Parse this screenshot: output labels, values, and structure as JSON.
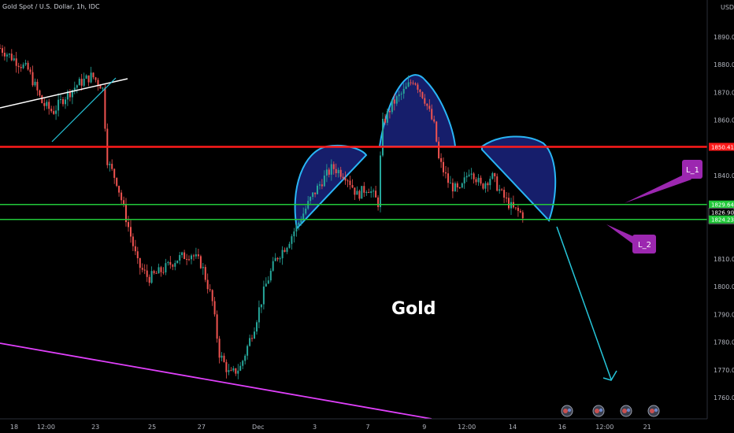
{
  "symbol": "Gold Spot / U.S. Dollar, 1h, IDC",
  "currency": "USD",
  "watermark_label": "Gold",
  "colors": {
    "background": "#000000",
    "up_candle": "#26a69a",
    "down_candle": "#ef5350",
    "resistance": "#ff1a1a",
    "support": "#22c93a",
    "pattern_fill": "#1a237e",
    "pattern_edge": "#29b6f6",
    "projection": "#26c6da",
    "callout": "#9c27b0",
    "trend_white": "#ffffff",
    "trend_magenta": "#e040fb",
    "trend_cyan": "#26c6da"
  },
  "chart_data": {
    "type": "candlestick",
    "title": "Gold Spot / U.S. Dollar, 1h, IDC",
    "ylim": [
      1752,
      1898
    ],
    "y_ticks": [
      "1760.00",
      "1770.00",
      "1780.00",
      "1790.00",
      "1800.00",
      "1810.00",
      "1830.00",
      "1840.00",
      "1860.00",
      "1870.00",
      "1880.00",
      "1890.00"
    ],
    "y_tick_values": [
      1760,
      1770,
      1780,
      1790,
      1800,
      1810,
      1830,
      1840,
      1860,
      1870,
      1880,
      1890
    ],
    "x_ticks": [
      "18",
      "12:00",
      "23",
      "25",
      "27",
      "Dec",
      "3",
      "7",
      "9",
      "12:00",
      "14",
      "16",
      "12:00",
      "21"
    ],
    "x_tick_positions": [
      0.02,
      0.065,
      0.135,
      0.215,
      0.285,
      0.365,
      0.445,
      0.52,
      0.6,
      0.66,
      0.725,
      0.795,
      0.855,
      0.915
    ],
    "price_series": [
      [
        0,
        1886
      ],
      [
        0.02,
        1882
      ],
      [
        0.04,
        1878
      ],
      [
        0.06,
        1866
      ],
      [
        0.075,
        1863
      ],
      [
        0.09,
        1868
      ],
      [
        0.11,
        1873
      ],
      [
        0.13,
        1876
      ],
      [
        0.145,
        1872
      ],
      [
        0.152,
        1845
      ],
      [
        0.165,
        1838
      ],
      [
        0.18,
        1823
      ],
      [
        0.195,
        1808
      ],
      [
        0.21,
        1803
      ],
      [
        0.23,
        1806
      ],
      [
        0.25,
        1810
      ],
      [
        0.27,
        1812
      ],
      [
        0.285,
        1808
      ],
      [
        0.3,
        1795
      ],
      [
        0.31,
        1776
      ],
      [
        0.325,
        1768
      ],
      [
        0.34,
        1771
      ],
      [
        0.36,
        1786
      ],
      [
        0.375,
        1800
      ],
      [
        0.39,
        1810
      ],
      [
        0.405,
        1815
      ],
      [
        0.42,
        1822
      ],
      [
        0.44,
        1832
      ],
      [
        0.455,
        1838
      ],
      [
        0.47,
        1843
      ],
      [
        0.49,
        1840
      ],
      [
        0.505,
        1833
      ],
      [
        0.52,
        1836
      ],
      [
        0.535,
        1830
      ],
      [
        0.54,
        1858
      ],
      [
        0.555,
        1866
      ],
      [
        0.57,
        1870
      ],
      [
        0.585,
        1875
      ],
      [
        0.6,
        1868
      ],
      [
        0.615,
        1857
      ],
      [
        0.62,
        1846
      ],
      [
        0.635,
        1837
      ],
      [
        0.65,
        1834
      ],
      [
        0.665,
        1843
      ],
      [
        0.68,
        1836
      ],
      [
        0.695,
        1840
      ],
      [
        0.71,
        1833
      ],
      [
        0.725,
        1828
      ],
      [
        0.74,
        1826
      ]
    ],
    "horizontal_levels": [
      {
        "value": 1850.41,
        "label": "1850.41",
        "kind": "resistance"
      },
      {
        "value": 1829.64,
        "label": "1829.64",
        "kind": "support"
      },
      {
        "value": 1826.9,
        "label": "1826.90",
        "kind": "current"
      },
      {
        "value": 1824.23,
        "label": "1824.23",
        "kind": "support"
      }
    ],
    "countdown": "39:41",
    "annotations": [
      {
        "label": "L_1"
      },
      {
        "label": "L_2"
      }
    ],
    "pattern": "head-and-shoulders",
    "grid": false,
    "legend": "top-left"
  }
}
